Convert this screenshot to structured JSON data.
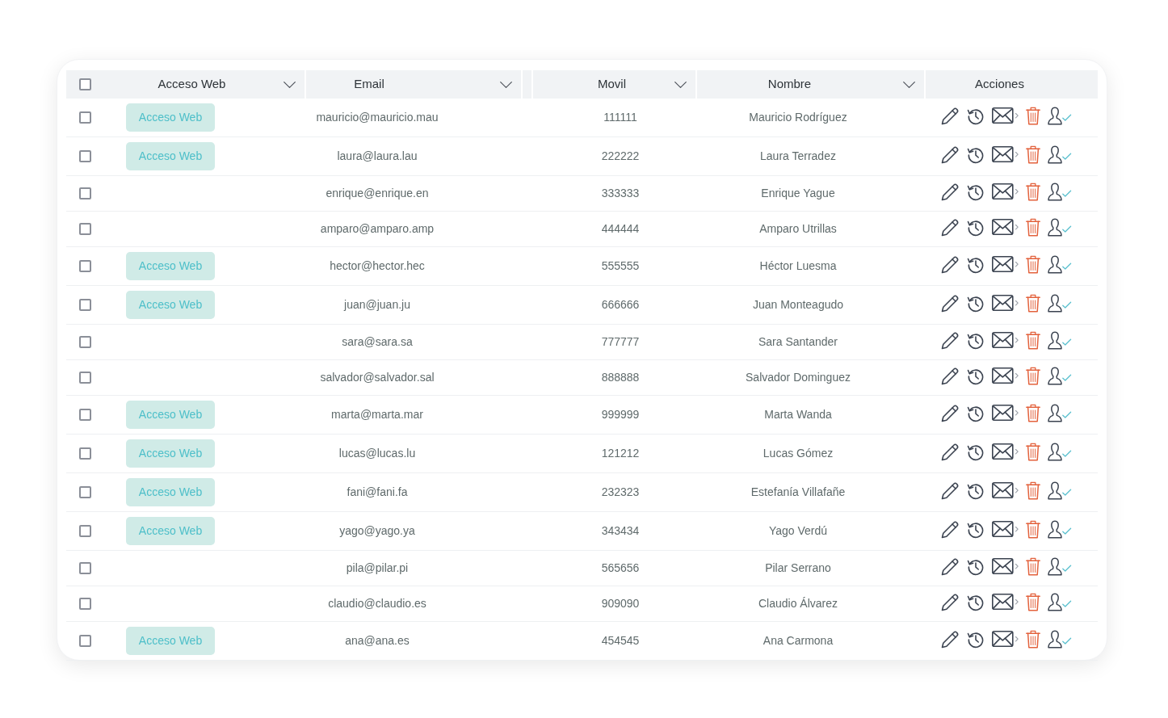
{
  "table": {
    "select_all": {
      "checked": false
    },
    "columns": [
      {
        "label": "Acceso Web",
        "kind": "dropdown"
      },
      {
        "label": "Email",
        "kind": "dropdown"
      },
      {
        "label": "Movil",
        "kind": "dropdown"
      },
      {
        "label": "Nombre",
        "kind": "dropdown"
      },
      {
        "label": "Acciones",
        "kind": "plain"
      }
    ],
    "rows": [
      {
        "checked": false,
        "web_access": "Acceso Web",
        "email": "mauricio@mauricio.mau",
        "movil": "111111",
        "nombre": "Mauricio Rodríguez"
      },
      {
        "checked": false,
        "web_access": "Acceso Web",
        "email": "laura@laura.lau",
        "movil": "222222",
        "nombre": "Laura Terradez"
      },
      {
        "checked": false,
        "email": "enrique@enrique.en",
        "movil": "333333",
        "nombre": "Enrique Yague"
      },
      {
        "checked": false,
        "email": "amparo@amparo.amp",
        "movil": "444444",
        "nombre": "Amparo Utrillas"
      },
      {
        "checked": false,
        "web_access": "Acceso Web",
        "email": "hector@hector.hec",
        "movil": "555555",
        "nombre": "Héctor Luesma"
      },
      {
        "checked": false,
        "web_access": "Acceso Web",
        "email": "juan@juan.ju",
        "movil": "666666",
        "nombre": "Juan Monteagudo"
      },
      {
        "checked": false,
        "email": "sara@sara.sa",
        "movil": "777777",
        "nombre": "Sara Santander"
      },
      {
        "checked": false,
        "email": "salvador@salvador.sal",
        "movil": "888888",
        "nombre": "Salvador Dominguez"
      },
      {
        "checked": false,
        "web_access": "Acceso Web",
        "email": "marta@marta.mar",
        "movil": "999999",
        "nombre": "Marta Wanda"
      },
      {
        "checked": false,
        "web_access": "Acceso Web",
        "email": "lucas@lucas.lu",
        "movil": "121212",
        "nombre": "Lucas Gómez"
      },
      {
        "checked": false,
        "web_access": "Acceso Web",
        "email": "fani@fani.fa",
        "movil": "232323",
        "nombre": "Estefanía Villafañe"
      },
      {
        "checked": false,
        "web_access": "Acceso Web",
        "email": "yago@yago.ya",
        "movil": "343434",
        "nombre": "Yago Verdú"
      },
      {
        "checked": false,
        "email": "pila@pilar.pi",
        "movil": "565656",
        "nombre": "Pilar Serrano"
      },
      {
        "checked": false,
        "email": "claudio@claudio.es",
        "movil": "909090",
        "nombre": "Claudio Álvarez"
      },
      {
        "checked": false,
        "web_access": "Acceso Web",
        "email": "ana@ana.es",
        "movil": "454545",
        "nombre": "Ana Carmona"
      }
    ]
  }
}
